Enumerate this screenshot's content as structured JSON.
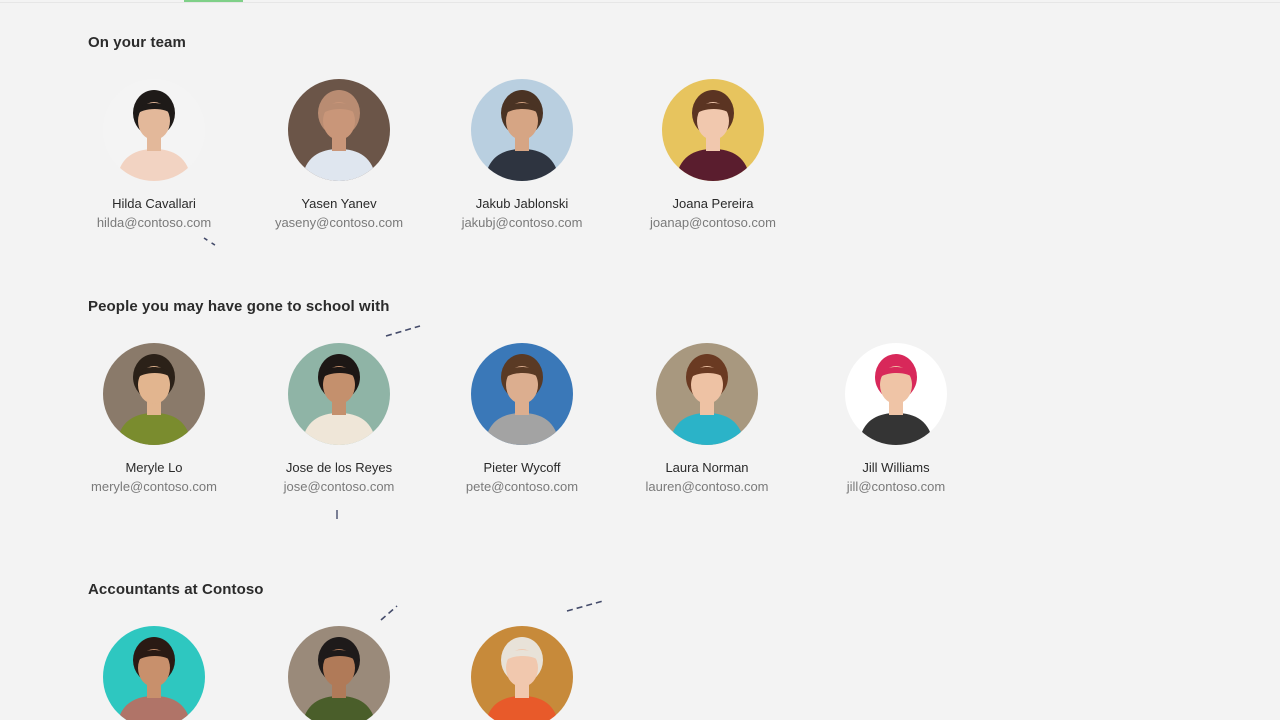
{
  "sections": [
    {
      "title": "On your team",
      "people": [
        {
          "name": "Hilda Cavallari",
          "email": "hilda@contoso.com",
          "bg": "#f4f4f4",
          "hair": "#1e1a18",
          "skin": "#e3b89a",
          "shirt": "#f2d3c2"
        },
        {
          "name": "Yasen Yanev",
          "email": "yaseny@contoso.com",
          "bg": "#6b5548",
          "hair": "#b98c72",
          "skin": "#c99679",
          "shirt": "#dfe6ef"
        },
        {
          "name": "Jakub Jablonski",
          "email": "jakubj@contoso.com",
          "bg": "#b9cfe0",
          "hair": "#4a3324",
          "skin": "#d6a584",
          "shirt": "#2e3440"
        },
        {
          "name": "Joana Pereira",
          "email": "joanap@contoso.com",
          "bg": "#e7c45e",
          "hair": "#5b3422",
          "skin": "#f1c8ae",
          "shirt": "#5a1d2e"
        }
      ]
    },
    {
      "title": "People you may have gone to school with",
      "people": [
        {
          "name": "Meryle Lo",
          "email": "meryle@contoso.com",
          "bg": "#8a7a6a",
          "hair": "#2b2118",
          "skin": "#e2b58f",
          "shirt": "#7a8c2e"
        },
        {
          "name": "Jose de los Reyes",
          "email": "jose@contoso.com",
          "bg": "#8fb4a6",
          "hair": "#1d1715",
          "skin": "#c4906d",
          "shirt": "#efe6d8"
        },
        {
          "name": "Pieter Wycoff",
          "email": "pete@contoso.com",
          "bg": "#3a78b8",
          "hair": "#5a3a24",
          "skin": "#dcae8f",
          "shirt": "#a3a3a3"
        },
        {
          "name": "Laura Norman",
          "email": "lauren@contoso.com",
          "bg": "#a8987f",
          "hair": "#6a3a22",
          "skin": "#eec2a4",
          "shirt": "#2bb3c8"
        },
        {
          "name": "Jill Williams",
          "email": "jill@contoso.com",
          "bg": "#ffffff",
          "hair": "#d8285a",
          "skin": "#efc4a6",
          "shirt": "#343434"
        }
      ]
    },
    {
      "title": "Accountants at Contoso",
      "people": [
        {
          "name": "",
          "email": "",
          "bg": "#2ec7c0",
          "hair": "#2a1a14",
          "skin": "#c8906c",
          "shirt": "#b07468"
        },
        {
          "name": "",
          "email": "",
          "bg": "#9a8a7a",
          "hair": "#1e1a1a",
          "skin": "#b07a58",
          "shirt": "#4a5e2a"
        },
        {
          "name": "",
          "email": "",
          "bg": "#c78a3a",
          "hair": "#e8e2d8",
          "skin": "#f1c8ae",
          "shirt": "#e85a2a"
        }
      ]
    }
  ]
}
